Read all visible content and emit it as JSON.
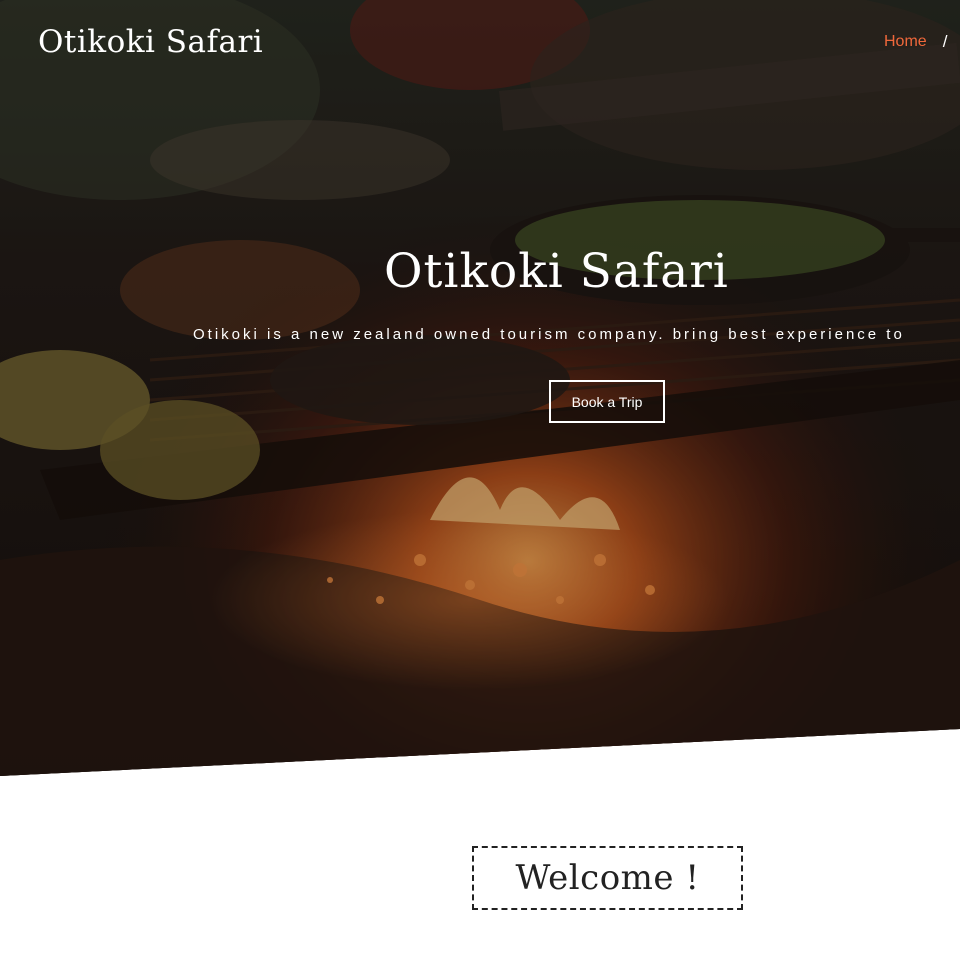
{
  "header": {
    "brand": "Otikoki Safari",
    "nav": [
      {
        "label": "Home",
        "active": true,
        "separator": "/"
      }
    ]
  },
  "hero": {
    "title": "Otikoki Safari",
    "subtitle": "Otikoki is a new zealand owned tourism company. bring best experience to",
    "cta_label": "Book a Trip"
  },
  "welcome": {
    "heading": "Welcome !"
  },
  "colors": {
    "accent": "#f0683b",
    "text_light": "#ffffff",
    "text_dark": "#222222",
    "background": "#ffffff"
  }
}
